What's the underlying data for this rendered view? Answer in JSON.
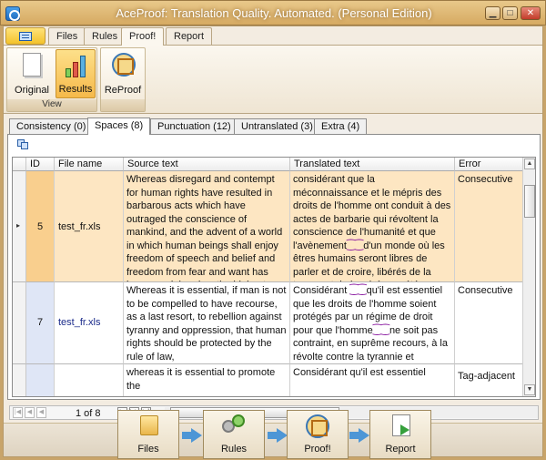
{
  "window": {
    "title": "AceProof: Translation Quality. Automated.  (Personal Edition)",
    "minimize": "▁",
    "maximize": "□",
    "close": "✕"
  },
  "ribbon": {
    "tabs": [
      {
        "label": "Files"
      },
      {
        "label": "Rules"
      },
      {
        "label": "Proof!"
      },
      {
        "label": "Report"
      }
    ],
    "active_tab": "Proof!",
    "view_group": {
      "label": "View",
      "buttons": [
        {
          "label": "Original",
          "icon": "document-icon"
        },
        {
          "label": "Results",
          "icon": "bar-chart-icon",
          "selected": true
        }
      ]
    },
    "reproof_button": {
      "label": "ReProof",
      "icon": "vitruvian-icon"
    }
  },
  "subtabs": [
    {
      "label": "Consistency (0)"
    },
    {
      "label": "Spaces (8)"
    },
    {
      "label": "Punctuation (12)"
    },
    {
      "label": "Untranslated (3)"
    },
    {
      "label": "Extra (4)"
    }
  ],
  "active_subtab": "Spaces (8)",
  "grid": {
    "columns": [
      "ID",
      "File name",
      "Source text",
      "Translated text",
      "Error"
    ],
    "rows": [
      {
        "id": "5",
        "file": "test_fr.xls",
        "source": "Whereas disregard and contempt for human rights have resulted in barbarous acts which have outraged the conscience of mankind, and the advent of  a world in which human beings shall enjoy freedom of speech and belief and freedom from fear and want has been proclaimed as the highest aspiration of the common people,",
        "translated_pre": "considérant que la méconnaissance et le mépris des droits de l'homme ont conduit à des actes de barbarie qui révoltent la conscience de l'humanité et que l'avènement",
        "translated_mark": "⁐⁐",
        "translated_post": "d'un monde où les êtres humains seront libres de parler et de croire, libérés de la terreur et de la misère, a été proclamé comme la plus haute aspiration de l'homme",
        "error": "Consecutive"
      },
      {
        "id": "7",
        "file": "test_fr.xls",
        "source": "Whereas it is essential, if man is not to be compelled to have recourse, as a last resort, to rebellion against tyranny and oppression, that human rights should be protected by the rule of law,",
        "translated_a": "Considérant ",
        "translated_mark1": "⁐⁐",
        "translated_b": "qu'il est essentiel que les droits de l'homme soient protégés par un régime de droit pour que l'homme",
        "translated_mark2": "⁐⁐",
        "translated_c": "ne soit pas contraint, en suprême recours, à la révolte contre la tyrannie et l'oppression",
        "error": "Consecutive"
      },
      {
        "id": "",
        "file": "",
        "source": "whereas it is essential to promote the",
        "translated": "Considérant qu'il est essentiel",
        "error": "Tag-adjacent"
      }
    ]
  },
  "pager": {
    "text": "1 of 8",
    "first": "|◀",
    "prev": "◀",
    "next": "▶",
    "next_page": "▶▶",
    "last": "▶|"
  },
  "workflow": [
    {
      "label": "Files",
      "icon": "folder-icon"
    },
    {
      "label": "Rules",
      "icon": "gears-icon"
    },
    {
      "label": "Proof!",
      "icon": "vitruvian-icon"
    },
    {
      "label": "Report",
      "icon": "report-icon"
    }
  ]
}
